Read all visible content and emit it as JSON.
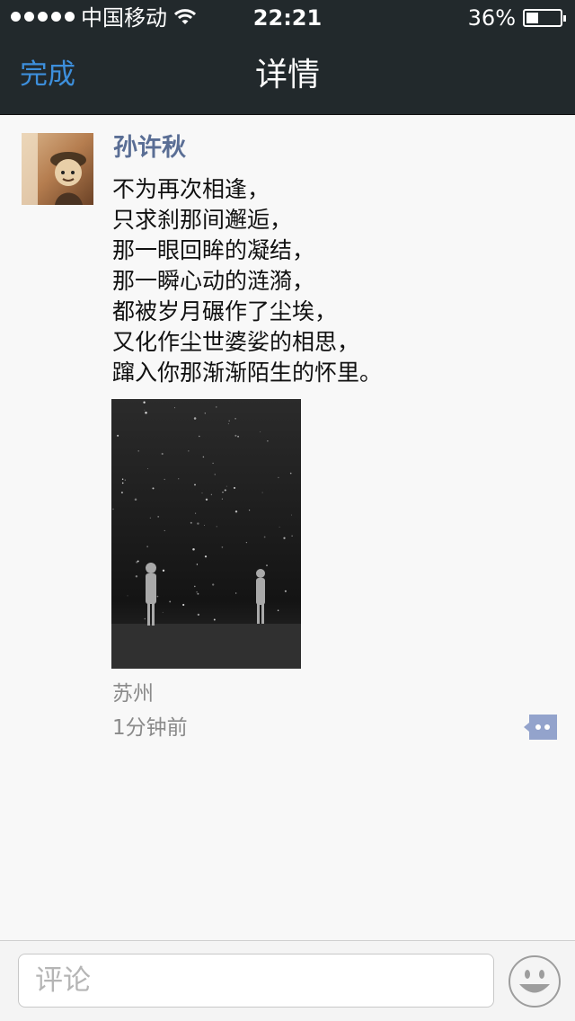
{
  "status_bar": {
    "carrier": "中国移动",
    "time": "22:21",
    "battery_percent": "36%",
    "battery_level": 0.36,
    "signal_bars": 5
  },
  "nav": {
    "done_label": "完成",
    "title": "详情"
  },
  "post": {
    "author": "孙许秋",
    "lines": [
      "不为再次相逢，",
      "只求刹那间邂逅，",
      "那一眼回眸的凝结，",
      "那一瞬心动的涟漪，",
      "都被岁月碾作了尘埃，",
      "又化作尘世婆娑的相思，",
      "蹿入你那渐渐陌生的怀里。"
    ],
    "location": "苏州",
    "time_ago": "1分钟前"
  },
  "comment": {
    "placeholder": "评论"
  },
  "icons": {
    "wifi": "wifi-icon",
    "battery": "battery-icon",
    "comment": "comment-bubble-icon",
    "emoji": "emoji-smile-icon"
  },
  "colors": {
    "bar_bg": "#22292c",
    "accent": "#3d8fdc",
    "author": "#5a6e95",
    "comment_icon": "#93a3cc"
  }
}
